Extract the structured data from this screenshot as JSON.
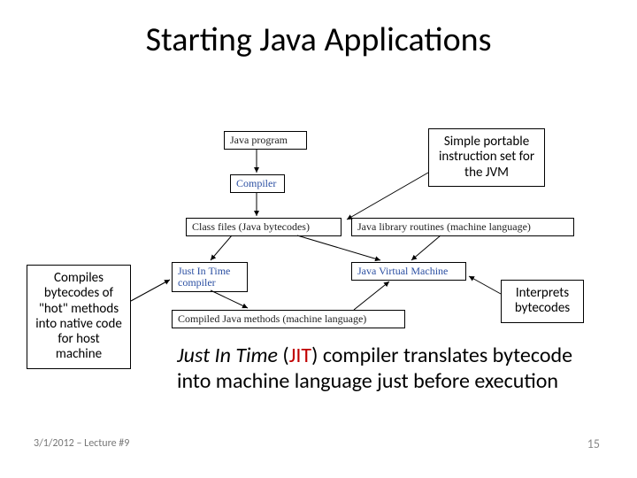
{
  "title": "Starting Java Applications",
  "diagram": {
    "java_program": "Java program",
    "compiler": "Compiler",
    "class_files": "Class files (Java bytecodes)",
    "java_library": "Java library routines (machine language)",
    "jit_compiler": "Just In Time compiler",
    "jvm": "Java Virtual Machine",
    "compiled_methods": "Compiled Java methods (machine language)"
  },
  "callouts": {
    "simple_portable": "Simple portable instruction set for the JVM",
    "compiles_hot": "Compiles bytecodes of \"hot\" methods into native code for host machine",
    "interprets": "Interprets bytecodes"
  },
  "body": {
    "jit_italic": "Just In Time",
    "jit_paren_open": " (",
    "jit_red": "JIT",
    "jit_paren_close": ") ",
    "jit_rest": "compiler translates bytecode into machine language just before execution"
  },
  "footer": {
    "left": "3/1/2012 – Lecture #9",
    "right": "15"
  }
}
